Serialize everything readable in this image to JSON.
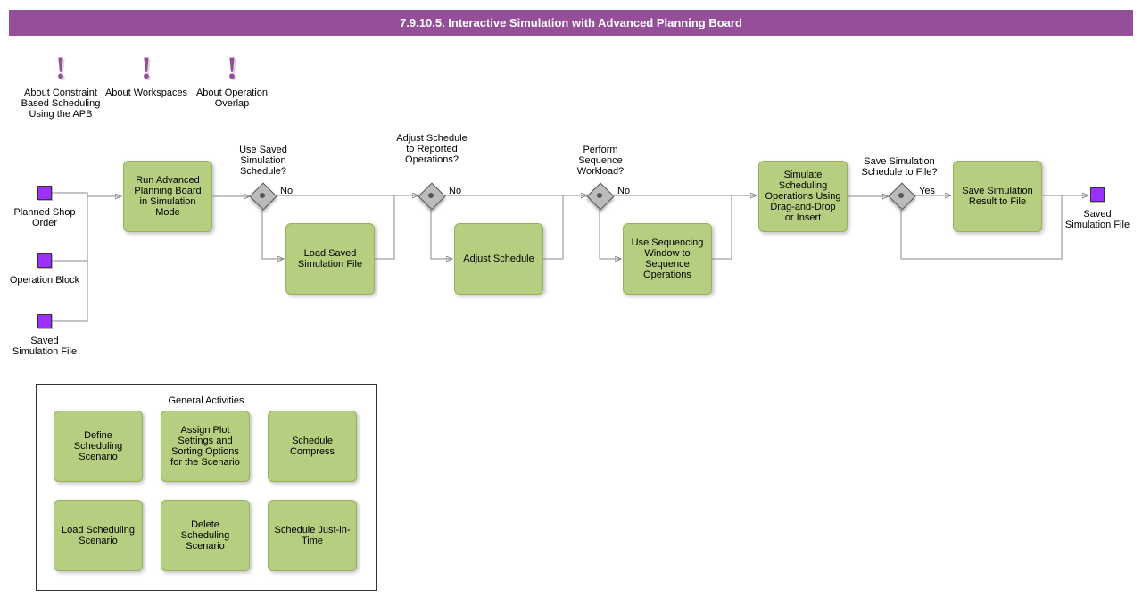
{
  "title": "7.9.10.5. Interactive Simulation with Advanced Planning Board",
  "notes": {
    "n1": "About Constraint Based Scheduling Using the APB",
    "n2": "About Workspaces",
    "n3": "About Operation Overlap"
  },
  "inputs": {
    "i1": "Planned Shop Order",
    "i2": "Operation Block",
    "i3": "Saved Simulation File"
  },
  "output": "Saved Simulation File",
  "acts": {
    "a1": "Run Advanced Planning Board in Simulation Mode",
    "a2": "Load Saved Simulation File",
    "a3": "Adjust Schedule",
    "a4": "Use Sequencing Window to Sequence Operations",
    "a5": "Simulate Scheduling Operations Using Drag-and-Drop or Insert",
    "a6": "Save Simulation Result to File"
  },
  "gw": {
    "g1q": "Use Saved Simulation Schedule?",
    "g2q": "Adjust Schedule to Reported Operations?",
    "g3q": "Perform Sequence Workload?",
    "g4q": "Save Simulation Schedule to File?",
    "no": "No",
    "yes": "Yes"
  },
  "ga": {
    "title": "General Activities",
    "c1": "Define Scheduling Scenario",
    "c2": "Assign Plot Settings and Sorting Options for the Scenario",
    "c3": "Schedule Compress",
    "c4": "Load Scheduling Scenario",
    "c5": "Delete Scheduling Scenario",
    "c6": "Schedule Just-in-Time"
  }
}
